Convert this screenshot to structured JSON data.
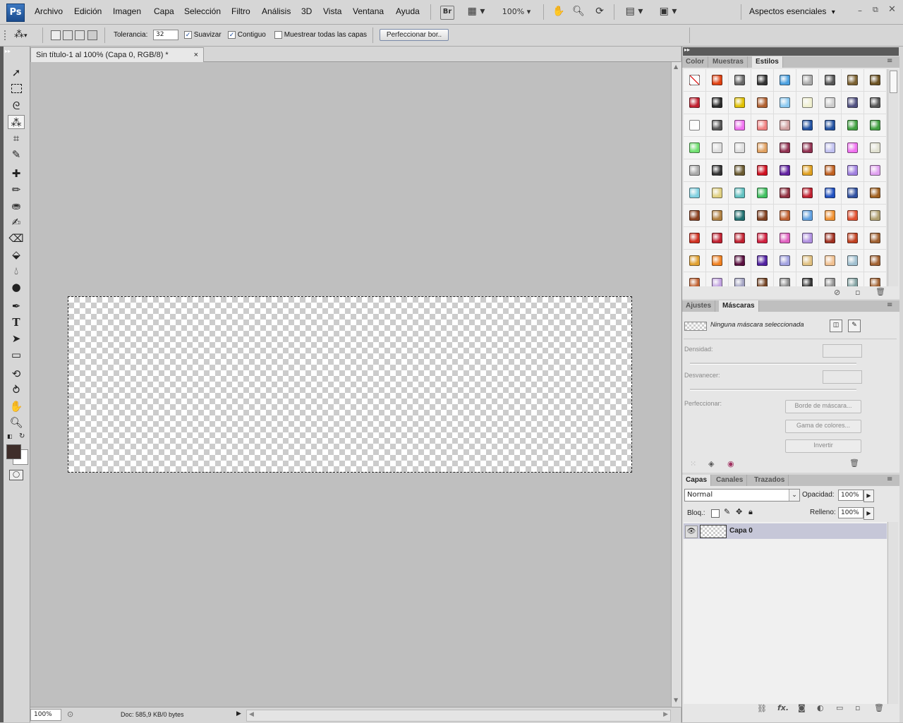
{
  "app": {
    "logo": "Ps",
    "workspace": "Aspectos esenciales",
    "zoom_menu": "100%"
  },
  "menu": [
    "Archivo",
    "Edición",
    "Imagen",
    "Capa",
    "Selección",
    "Filtro",
    "Análisis",
    "3D",
    "Vista",
    "Ventana",
    "Ayuda"
  ],
  "menubar_icons": [
    "bridge-icon",
    "mini-bridge-icon",
    "hand-icon",
    "zoom-icon",
    "rotate-icon",
    "arrange-icon",
    "screen-mode-icon"
  ],
  "bridge_label": "Br",
  "options": {
    "tolerance_label": "Tolerancia:",
    "tolerance_value": "32",
    "antialias_label": "Suavizar",
    "contiguous_label": "Contiguo",
    "sample_all_label": "Muestrear todas las capas",
    "refine_button": "Perfeccionar bor.."
  },
  "document": {
    "tab_title": "Sin título-1 al 100% (Capa 0, RGB/8) *",
    "zoom": "100%",
    "doc_info": "Doc: 585,9 KB/0 bytes"
  },
  "style_panel": {
    "tabs": [
      "Color",
      "Muestras",
      "Estilos"
    ],
    "active_tab": "Estilos"
  },
  "masks_panel": {
    "tabs": [
      "Ajustes",
      "Máscaras"
    ],
    "active_tab": "Máscaras",
    "no_mask": "Ninguna máscara seleccionada",
    "density": "Densidad:",
    "feather": "Desvanecer:",
    "refine": "Perfeccionar:",
    "mask_edge_button": "Borde de máscara...",
    "color_range_button": "Gama de colores...",
    "invert_button": "Invertir"
  },
  "layers_panel": {
    "tabs": [
      "Capas",
      "Canales",
      "Trazados"
    ],
    "active_tab": "Capas",
    "blend_mode": "Normal",
    "opacity_label": "Opacidad:",
    "opacity_value": "100%",
    "lock_label": "Bloq.:",
    "fill_label": "Relleno:",
    "fill_value": "100%",
    "layers": [
      {
        "name": "Capa 0",
        "visible": true
      }
    ]
  },
  "colors": {
    "foreground": "#3f2e2a",
    "background": "#ffffff",
    "ui": "#d6d6d6",
    "canvas_bg": "#bfbfbf"
  }
}
